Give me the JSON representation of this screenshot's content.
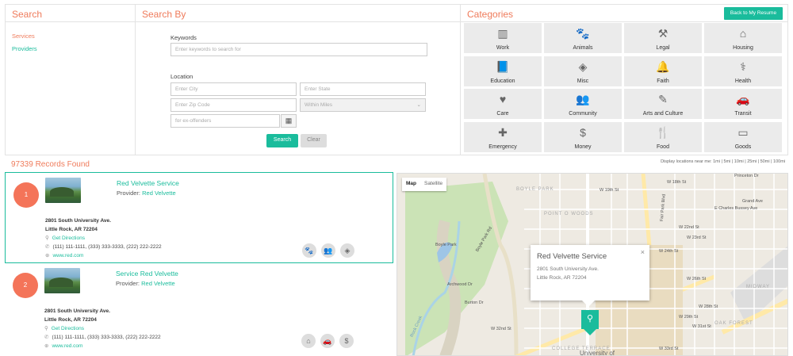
{
  "search": {
    "title": "Search",
    "links": [
      "Services",
      "Providers"
    ]
  },
  "search_by": {
    "title": "Search By",
    "keywords_label": "Keywords",
    "keywords_placeholder": "Enter keywords to search for",
    "location_label": "Location",
    "city_placeholder": "Enter City",
    "state_placeholder": "Enter State",
    "zip_placeholder": "Enter Zip Code",
    "miles_value": "Within Miles",
    "offenders_placeholder": "for ex-offenders",
    "search_button": "Search",
    "clear_button": "Clear"
  },
  "categories": {
    "title": "Categories",
    "back_button": "Back to My Resume",
    "items": [
      {
        "label": "Work",
        "icon": "building-icon"
      },
      {
        "label": "Animals",
        "icon": "paw-icon"
      },
      {
        "label": "Legal",
        "icon": "gavel-icon"
      },
      {
        "label": "Housing",
        "icon": "home-icon"
      },
      {
        "label": "Education",
        "icon": "book-icon"
      },
      {
        "label": "Misc",
        "icon": "cube-icon"
      },
      {
        "label": "Faith",
        "icon": "bell-icon"
      },
      {
        "label": "Health",
        "icon": "stethoscope-icon"
      },
      {
        "label": "Care",
        "icon": "heart-icon"
      },
      {
        "label": "Community",
        "icon": "users-icon"
      },
      {
        "label": "Arts and Culture",
        "icon": "brush-icon"
      },
      {
        "label": "Transit",
        "icon": "car-icon"
      },
      {
        "label": "Emergency",
        "icon": "medkit-icon"
      },
      {
        "label": "Money",
        "icon": "money-icon"
      },
      {
        "label": "Food",
        "icon": "cutlery-icon"
      },
      {
        "label": "Goods",
        "icon": "hdd-icon"
      }
    ]
  },
  "results": {
    "count_text": "97339 Records Found",
    "display_text": "Display locations near me: 1mi | 5mi | 10mi | 25mi | 50mi | 100mi",
    "items": [
      {
        "number": "1",
        "title": "Red Velvette Service",
        "provider_label": "Provider:",
        "provider": "Red Velvette",
        "address1": "2801 South University Ave.",
        "address2": "Little Rock, AR 72204",
        "directions": "Get Directions",
        "phones": "(111) 111-1111, (333) 333-3333, (222) 222-2222",
        "website": "www.red.com",
        "icons": [
          "paw-icon",
          "users-icon",
          "cube-icon"
        ]
      },
      {
        "number": "2",
        "title": "Service Red Velvette",
        "provider_label": "Provider:",
        "provider": "Red Velvette",
        "address1": "2801 South University Ave.",
        "address2": "Little Rock, AR 72204",
        "directions": "Get Directions",
        "phones": "(111) 111-1111, (333) 333-3333, (222) 222-2222",
        "website": "www.red.com",
        "icons": [
          "home-icon",
          "car-icon",
          "money-icon"
        ]
      }
    ]
  },
  "map": {
    "type_map": "Map",
    "type_satellite": "Satellite",
    "popup_title": "Red Velvette Service",
    "popup_line1": "2801 South University Ave.",
    "popup_line2": "Little Rock, AR 72204",
    "close": "×",
    "labels": {
      "boyle_park_upper": "BOYLE PARK",
      "point_o_woods": "POINT O WOODS",
      "boyle_park": "Boyle Park",
      "college_terrace": "COLLEGE TERRACE",
      "midway": "MIDWAY",
      "oak_forest": "OAK FOREST",
      "university": "University of",
      "w19th": "W 19th St",
      "w18th": "W 18th St",
      "w22nd": "W 22nd St",
      "w23rd": "W 23rd St",
      "w24th": "W 24th St",
      "w26th": "W 26th St",
      "w28th": "W 28th St",
      "w29th": "W 29th St",
      "w31st": "W 31st St",
      "w32nd": "W 32nd St",
      "w33rd": "W 33rd St",
      "archwood": "Archwood Dr",
      "burton": "Burton Dr",
      "fair_park": "Fair Park Blvd",
      "grand": "Grand Ave",
      "bussey": "E Charles Bussey Ave",
      "princeton": "Princeton Dr",
      "rock_creek": "Rock Creek",
      "boyle_park_rd": "Boyle Park Rd"
    }
  },
  "colors": {
    "accent": "#1abc9c",
    "title_orange": "#ef7b5b",
    "badge": "#f47459"
  }
}
